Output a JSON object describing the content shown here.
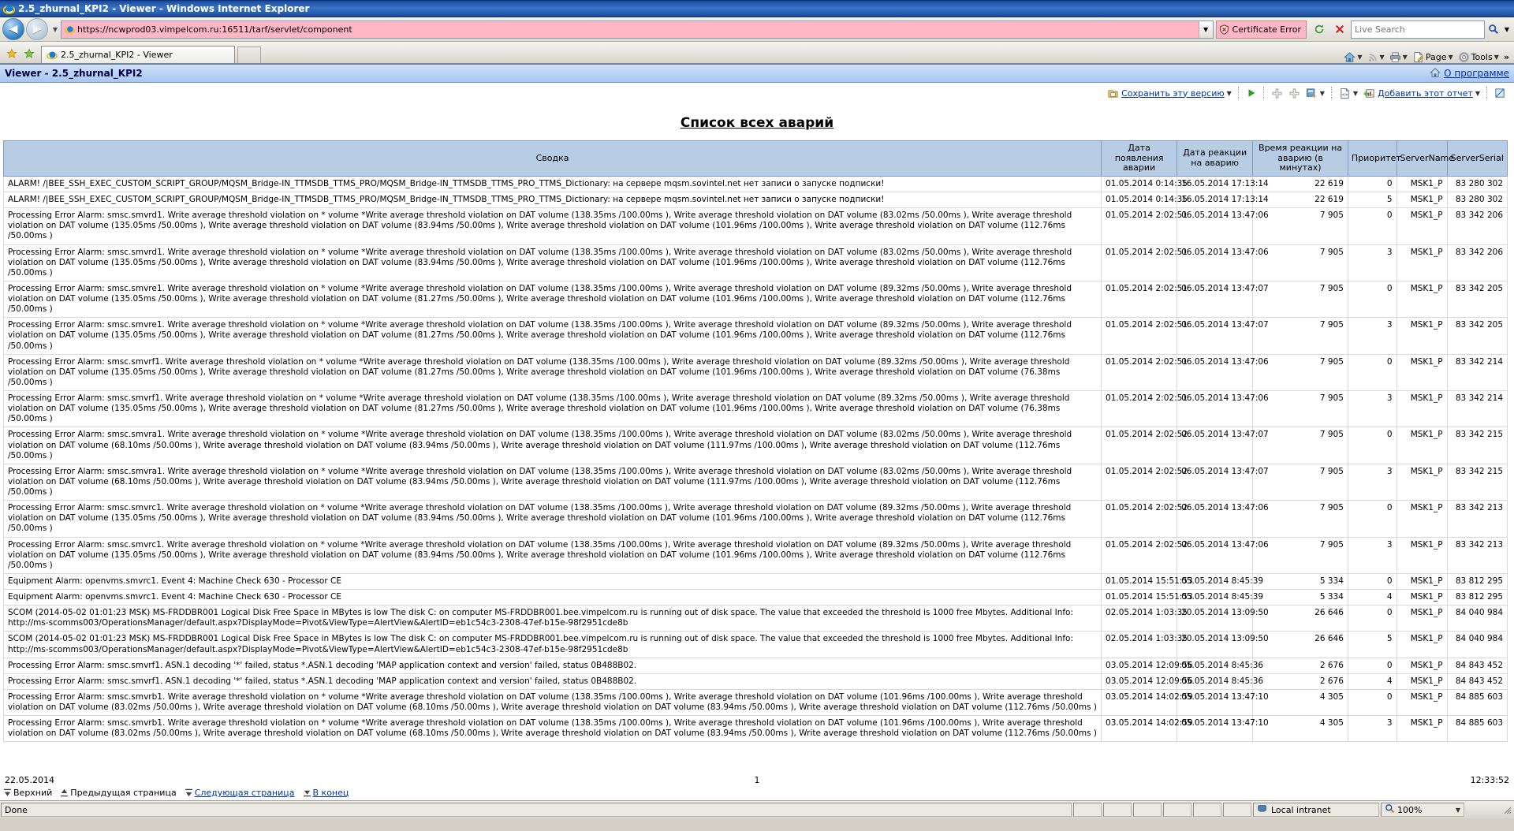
{
  "window": {
    "title": "2.5_zhurnal_KPI2 - Viewer - Windows Internet Explorer"
  },
  "browser": {
    "address": "https://ncwprod03.vimpelcom.ru:16511/tarf/servlet/component",
    "certificate_error": "Certificate Error",
    "search_placeholder": "Live Search",
    "tab_label": "2.5_zhurnal_KPI2 - Viewer",
    "toolbar": {
      "page_label": "Page",
      "tools_label": "Tools",
      "overflow": "»"
    }
  },
  "app": {
    "header_title": "Viewer - 2.5_zhurnal_KPI2",
    "about_link": "О программе"
  },
  "report_toolbar": {
    "save_version": "Сохранить эту версию",
    "add_report": "Добавить этот отчет"
  },
  "report": {
    "title": "Список всех аварий",
    "columns": [
      "Сводка",
      "Дата появления аварии",
      "Дата реакции на аварию",
      "Время реакции на аварию (в минутах)",
      "Приоритет",
      "ServerName",
      "ServerSerial"
    ],
    "rows": [
      {
        "summary": "ALARM! /|BEE_SSH_EXEC_CUSTOM_SCRIPT_GROUP/MQSM_Bridge-IN_TTMSDB_TTMS_PRO/MQSM_Bridge-IN_TTMSDB_TTMS_PRO_TTMS_Dictionary: на сервере mqsm.sovintel.net нет записи о запуске подписки!",
        "date_appear": "01.05.2014 0:14:35",
        "date_react": "16.05.2014 17:13:14",
        "react_time": "22 619",
        "priority": "0",
        "server_name": "MSK1_P",
        "server_serial": "83 280 302"
      },
      {
        "summary": "ALARM! /|BEE_SSH_EXEC_CUSTOM_SCRIPT_GROUP/MQSM_Bridge-IN_TTMSDB_TTMS_PRO/MQSM_Bridge-IN_TTMSDB_TTMS_PRO_TTMS_Dictionary: на сервере mqsm.sovintel.net нет записи о запуске подписки!",
        "date_appear": "01.05.2014 0:14:35",
        "date_react": "16.05.2014 17:13:14",
        "react_time": "22 619",
        "priority": "5",
        "server_name": "MSK1_P",
        "server_serial": "83 280 302"
      },
      {
        "summary": "Processing Error Alarm: smsc.smvrd1. Write average threshold violation on * volume *Write average threshold violation on DAT volume (138.35ms /100.00ms ), Write average threshold violation on DAT volume (83.02ms /50.00ms ), Write average threshold violation on DAT volume (135.05ms /50.00ms ), Write average threshold violation on DAT volume (83.94ms /50.00ms ), Write average threshold violation on DAT volume (101.96ms /100.00ms ), Write average threshold violation on DAT volume (112.76ms /50.00ms )",
        "date_appear": "01.05.2014 2:02:51",
        "date_react": "06.05.2014 13:47:06",
        "react_time": "7 905",
        "priority": "0",
        "server_name": "MSK1_P",
        "server_serial": "83 342 206"
      },
      {
        "summary": "Processing Error Alarm: smsc.smvrd1. Write average threshold violation on * volume *Write average threshold violation on DAT volume (138.35ms /100.00ms ), Write average threshold violation on DAT volume (83.02ms /50.00ms ), Write average threshold violation on DAT volume (135.05ms /50.00ms ), Write average threshold violation on DAT volume (83.94ms /50.00ms ), Write average threshold violation on DAT volume (101.96ms /100.00ms ), Write average threshold violation on DAT volume (112.76ms /50.00ms )",
        "date_appear": "01.05.2014 2:02:51",
        "date_react": "06.05.2014 13:47:06",
        "react_time": "7 905",
        "priority": "3",
        "server_name": "MSK1_P",
        "server_serial": "83 342 206"
      },
      {
        "summary": "Processing Error Alarm: smsc.smvre1. Write average threshold violation on * volume *Write average threshold violation on DAT volume (138.35ms /100.00ms ), Write average threshold violation on DAT volume (89.32ms /50.00ms ), Write average threshold violation on DAT volume (135.05ms /50.00ms ), Write average threshold violation on DAT volume (81.27ms /50.00ms ), Write average threshold violation on DAT volume (101.96ms /100.00ms ), Write average threshold violation on DAT volume (112.76ms /50.00ms )",
        "date_appear": "01.05.2014 2:02:51",
        "date_react": "06.05.2014 13:47:07",
        "react_time": "7 905",
        "priority": "0",
        "server_name": "MSK1_P",
        "server_serial": "83 342 205"
      },
      {
        "summary": "Processing Error Alarm: smsc.smvre1. Write average threshold violation on * volume *Write average threshold violation on DAT volume (138.35ms /100.00ms ), Write average threshold violation on DAT volume (89.32ms /50.00ms ), Write average threshold violation on DAT volume (135.05ms /50.00ms ), Write average threshold violation on DAT volume (81.27ms /50.00ms ), Write average threshold violation on DAT volume (101.96ms /100.00ms ), Write average threshold violation on DAT volume (112.76ms /50.00ms )",
        "date_appear": "01.05.2014 2:02:51",
        "date_react": "06.05.2014 13:47:07",
        "react_time": "7 905",
        "priority": "3",
        "server_name": "MSK1_P",
        "server_serial": "83 342 205"
      },
      {
        "summary": "Processing Error Alarm: smsc.smvrf1. Write average threshold violation on * volume *Write average threshold violation on DAT volume (138.35ms /100.00ms ), Write average threshold violation on DAT volume (89.32ms /50.00ms ), Write average threshold violation on DAT volume (135.05ms /50.00ms ), Write average threshold violation on DAT volume (81.27ms /50.00ms ), Write average threshold violation on DAT volume (101.96ms /100.00ms ), Write average threshold violation on DAT volume (76.38ms /50.00ms )",
        "date_appear": "01.05.2014 2:02:51",
        "date_react": "06.05.2014 13:47:06",
        "react_time": "7 905",
        "priority": "0",
        "server_name": "MSK1_P",
        "server_serial": "83 342 214"
      },
      {
        "summary": "Processing Error Alarm: smsc.smvrf1. Write average threshold violation on * volume *Write average threshold violation on DAT volume (138.35ms /100.00ms ), Write average threshold violation on DAT volume (89.32ms /50.00ms ), Write average threshold violation on DAT volume (135.05ms /50.00ms ), Write average threshold violation on DAT volume (81.27ms /50.00ms ), Write average threshold violation on DAT volume (101.96ms /100.00ms ), Write average threshold violation on DAT volume (76.38ms /50.00ms )",
        "date_appear": "01.05.2014 2:02:51",
        "date_react": "06.05.2014 13:47:06",
        "react_time": "7 905",
        "priority": "3",
        "server_name": "MSK1_P",
        "server_serial": "83 342 214"
      },
      {
        "summary": "Processing Error Alarm: smsc.smvra1. Write average threshold violation on * volume *Write average threshold violation on DAT volume (138.35ms /100.00ms ), Write average threshold violation on DAT volume (83.02ms /50.00ms ), Write average threshold violation on DAT volume (68.10ms /50.00ms ), Write average threshold violation on DAT volume (83.94ms /50.00ms ), Write average threshold violation on DAT volume (111.97ms /100.00ms ), Write average threshold violation on DAT volume (112.76ms /50.00ms )",
        "date_appear": "01.05.2014 2:02:52",
        "date_react": "06.05.2014 13:47:07",
        "react_time": "7 905",
        "priority": "0",
        "server_name": "MSK1_P",
        "server_serial": "83 342 215"
      },
      {
        "summary": "Processing Error Alarm: smsc.smvra1. Write average threshold violation on * volume *Write average threshold violation on DAT volume (138.35ms /100.00ms ), Write average threshold violation on DAT volume (83.02ms /50.00ms ), Write average threshold violation on DAT volume (68.10ms /50.00ms ), Write average threshold violation on DAT volume (83.94ms /50.00ms ), Write average threshold violation on DAT volume (111.97ms /100.00ms ), Write average threshold violation on DAT volume (112.76ms /50.00ms )",
        "date_appear": "01.05.2014 2:02:52",
        "date_react": "06.05.2014 13:47:07",
        "react_time": "7 905",
        "priority": "3",
        "server_name": "MSK1_P",
        "server_serial": "83 342 215"
      },
      {
        "summary": "Processing Error Alarm: smsc.smvrc1. Write average threshold violation on * volume *Write average threshold violation on DAT volume (138.35ms /100.00ms ), Write average threshold violation on DAT volume (89.32ms /50.00ms ), Write average threshold violation on DAT volume (135.05ms /50.00ms ), Write average threshold violation on DAT volume (83.94ms /50.00ms ), Write average threshold violation on DAT volume (101.96ms /100.00ms ), Write average threshold violation on DAT volume (112.76ms /50.00ms )",
        "date_appear": "01.05.2014 2:02:52",
        "date_react": "06.05.2014 13:47:06",
        "react_time": "7 905",
        "priority": "0",
        "server_name": "MSK1_P",
        "server_serial": "83 342 213"
      },
      {
        "summary": "Processing Error Alarm: smsc.smvrc1. Write average threshold violation on * volume *Write average threshold violation on DAT volume (138.35ms /100.00ms ), Write average threshold violation on DAT volume (89.32ms /50.00ms ), Write average threshold violation on DAT volume (135.05ms /50.00ms ), Write average threshold violation on DAT volume (83.94ms /50.00ms ), Write average threshold violation on DAT volume (101.96ms /100.00ms ), Write average threshold violation on DAT volume (112.76ms /50.00ms )",
        "date_appear": "01.05.2014 2:02:52",
        "date_react": "06.05.2014 13:47:06",
        "react_time": "7 905",
        "priority": "3",
        "server_name": "MSK1_P",
        "server_serial": "83 342 213"
      },
      {
        "summary": "Equipment Alarm: openvms.smvrc1. Event 4: Machine Check 630 - Processor CE",
        "date_appear": "01.05.2014 15:51:53",
        "date_react": "05.05.2014 8:45:39",
        "react_time": "5 334",
        "priority": "0",
        "server_name": "MSK1_P",
        "server_serial": "83 812 295"
      },
      {
        "summary": "Equipment Alarm: openvms.smvrc1. Event 4: Machine Check 630 - Processor CE",
        "date_appear": "01.05.2014 15:51:53",
        "date_react": "05.05.2014 8:45:39",
        "react_time": "5 334",
        "priority": "4",
        "server_name": "MSK1_P",
        "server_serial": "83 812 295"
      },
      {
        "summary": "SCOM (2014-05-02 01:01:23 MSK) MS-FRDDBR001 Logical Disk Free Space in MBytes is low The disk C: on computer MS-FRDDBR001.bee.vimpelcom.ru is running out of disk space. The value that exceeded the threshold is 1000 free Mbytes. Additional Info: http://ms-scomms003/OperationsManager/default.aspx?DisplayMode=Pivot&ViewType=AlertView&AlertID=eb1c54c3-2308-47ef-b15e-98f2951cde8b",
        "date_appear": "02.05.2014 1:03:35",
        "date_react": "20.05.2014 13:09:50",
        "react_time": "26 646",
        "priority": "0",
        "server_name": "MSK1_P",
        "server_serial": "84 040 984"
      },
      {
        "summary": "SCOM (2014-05-02 01:01:23 MSK) MS-FRDDBR001 Logical Disk Free Space in MBytes is low The disk C: on computer MS-FRDDBR001.bee.vimpelcom.ru is running out of disk space. The value that exceeded the threshold is 1000 free Mbytes. Additional Info: http://ms-scomms003/OperationsManager/default.aspx?DisplayMode=Pivot&ViewType=AlertView&AlertID=eb1c54c3-2308-47ef-b15e-98f2951cde8b",
        "date_appear": "02.05.2014 1:03:35",
        "date_react": "20.05.2014 13:09:50",
        "react_time": "26 646",
        "priority": "5",
        "server_name": "MSK1_P",
        "server_serial": "84 040 984"
      },
      {
        "summary": "Processing Error Alarm: smsc.smvrf1. ASN.1 decoding '*' failed, status *.ASN.1 decoding 'MAP application context and version' failed, status 0B488B02.",
        "date_appear": "03.05.2014 12:09:56",
        "date_react": "05.05.2014 8:45:36",
        "react_time": "2 676",
        "priority": "0",
        "server_name": "MSK1_P",
        "server_serial": "84 843 452"
      },
      {
        "summary": "Processing Error Alarm: smsc.smvrf1. ASN.1 decoding '*' failed, status *.ASN.1 decoding 'MAP application context and version' failed, status 0B488B02.",
        "date_appear": "03.05.2014 12:09:56",
        "date_react": "05.05.2014 8:45:36",
        "react_time": "2 676",
        "priority": "4",
        "server_name": "MSK1_P",
        "server_serial": "84 843 452"
      },
      {
        "summary": "Processing Error Alarm: smsc.smvrb1. Write average threshold violation on * volume *Write average threshold violation on DAT volume (138.35ms /100.00ms ), Write average threshold violation on DAT volume (101.96ms /100.00ms ), Write average threshold violation on DAT volume (83.02ms /50.00ms ), Write average threshold violation on DAT volume (68.10ms /50.00ms ), Write average threshold violation on DAT volume (83.94ms /50.00ms ), Write average threshold violation on DAT volume (112.76ms /50.00ms )",
        "date_appear": "03.05.2014 14:02:59",
        "date_react": "05.05.2014 13:47:10",
        "react_time": "4 305",
        "priority": "0",
        "server_name": "MSK1_P",
        "server_serial": "84 885 603"
      },
      {
        "summary": "Processing Error Alarm: smsc.smvrb1. Write average threshold violation on * volume *Write average threshold violation on DAT volume (138.35ms /100.00ms ), Write average threshold violation on DAT volume (101.96ms /100.00ms ), Write average threshold violation on DAT volume (83.02ms /50.00ms ), Write average threshold violation on DAT volume (68.10ms /50.00ms ), Write average threshold violation on DAT volume (83.94ms /50.00ms ), Write average threshold violation on DAT volume (112.76ms /50.00ms )",
        "date_appear": "03.05.2014 14:02:59",
        "date_react": "05.05.2014 13:47:10",
        "react_time": "4 305",
        "priority": "3",
        "server_name": "MSK1_P",
        "server_serial": "84 885 603"
      }
    ],
    "footer": {
      "date": "22.05.2014",
      "page_number": "1",
      "time": "12:33:52"
    },
    "pager": {
      "top": "Верхний",
      "prev": "Предыдущая страница",
      "next": "Следующая страница",
      "end": "В конец"
    }
  },
  "statusbar": {
    "status": "Done",
    "zone": "Local intranet",
    "zoom": "100%"
  }
}
